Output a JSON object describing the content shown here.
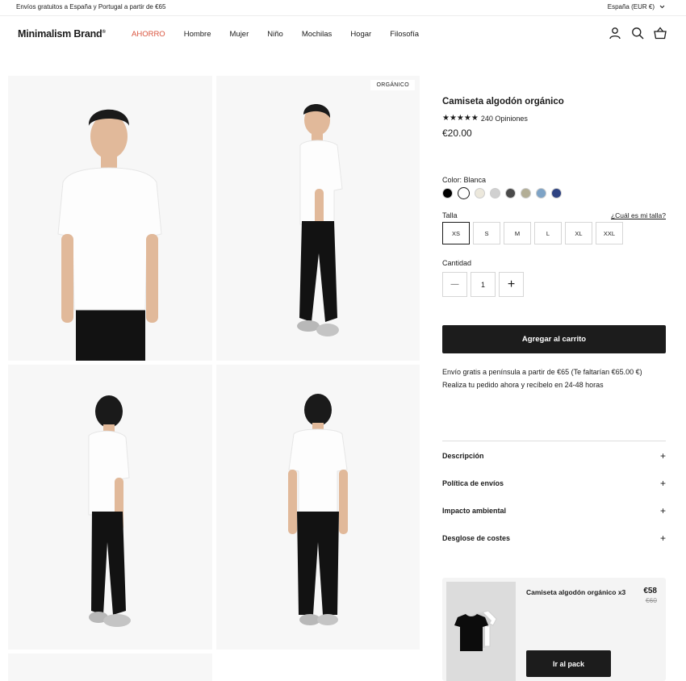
{
  "topbar": {
    "promo": "Envíos gratuitos a España y Portugal a partir de €65",
    "region": "España (EUR €)"
  },
  "header": {
    "brand": "Minimalism Brand",
    "brand_mark": "®",
    "nav": [
      "AHORRO",
      "Hombre",
      "Mujer",
      "Niño",
      "Mochilas",
      "Hogar",
      "Filosofía"
    ],
    "icons": [
      "account-icon",
      "search-icon",
      "basket-icon"
    ]
  },
  "gallery": {
    "tag": "ORGÁNICO"
  },
  "product": {
    "title": "Camiseta algodón orgánico",
    "stars": "★★★★★",
    "rating_count": "240 Opiniones",
    "price": "€20.00",
    "color_label": "Color:",
    "color_value": "Blanca",
    "colors": [
      "#000000",
      "#ffffff",
      "#ece8dc",
      "#d0d0d0",
      "#4a4a4a",
      "#b3ae96",
      "#7ea3c6",
      "#2e4382"
    ],
    "size_label": "Talla",
    "size_guide": "¿Cuál es mi talla?",
    "sizes": [
      "XS",
      "S",
      "M",
      "L",
      "XL",
      "XXL"
    ],
    "quantity_label": "Cantidad",
    "quantity": "1",
    "minus": "—",
    "plus": "+",
    "add_to_cart": "Agregar al carrito",
    "shipping_line1": "Envío gratis a península a partir de €65 (Te faltarían €65.00 €)",
    "shipping_line2": "Realiza tu pedido ahora y recíbelo en 24-48 horas",
    "accordion": [
      "Descripción",
      "Política de envíos",
      "Impacto ambiental",
      "Desglose de costes"
    ],
    "accordion_icon": "+"
  },
  "pack": {
    "title": "Camiseta algodón orgánico x3",
    "price": "€58",
    "old_price": "€60",
    "button": "Ir al pack"
  }
}
